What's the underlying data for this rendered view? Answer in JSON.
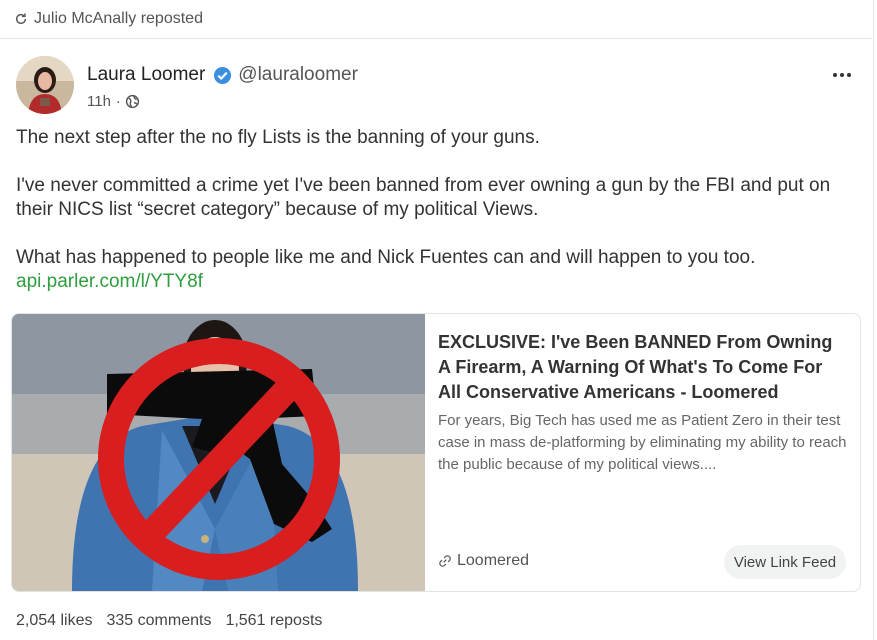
{
  "repost": {
    "icon": "repost-icon",
    "label": "Julio McAnally reposted"
  },
  "author": {
    "name": "Laura Loomer",
    "verified_icon": "verified-badge-icon",
    "handle": "@lauraloomer",
    "time": "11h",
    "separator": "·",
    "visibility_icon": "globe-icon"
  },
  "more_icon": "more-options-icon",
  "post": {
    "paragraph1": "The next step after the no fly Lists is the banning of your guns.",
    "paragraph2": "I've never committed a crime yet I've been banned from ever owning a gun by the FBI and put on their NICS list “secret category” because of my political Views.",
    "paragraph3": "What has happened to people like me and Nick Fuentes can and will happen to you too.",
    "link": "api.parler.com/l/YTY8f"
  },
  "link_card": {
    "title": "EXCLUSIVE: I've Been BANNED From Owning A Firearm, A Warning Of What's To Come For All Conservative Americans - Loomered",
    "description": "For years, Big Tech has used me as Patient Zero in their test case in mass de-platforming by eliminating my ability to reach the public because of my political views....",
    "source_icon": "link-icon",
    "source": "Loomered",
    "button": "View Link Feed"
  },
  "stats": {
    "likes": "2,054 likes",
    "comments": "335 comments",
    "reposts": "1,561 reposts"
  },
  "colors": {
    "link": "#2e9e3e",
    "verified": "#3b8fe0",
    "ban_sign": "#d81e1e"
  }
}
